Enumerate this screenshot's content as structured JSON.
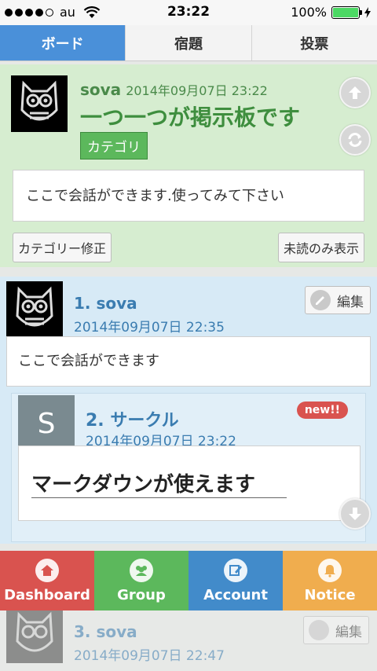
{
  "status": {
    "carrier": "au",
    "time": "23:22",
    "battery": "100%"
  },
  "tabs": [
    {
      "label": "ボード"
    },
    {
      "label": "宿題"
    },
    {
      "label": "投票"
    }
  ],
  "board": {
    "author": "sova",
    "date": "2014年09月07日 23:22",
    "title": "一つ一つが掲示板です",
    "category": "カテゴリ",
    "description": "ここで会話ができます.使ってみて下さい",
    "category_button": "カテゴリー修正",
    "unread_button": "未読のみ表示"
  },
  "posts": [
    {
      "name": "1. sova",
      "date": "2014年09月07日 22:35",
      "edit_label": "編集",
      "body": "ここで会話ができます"
    },
    {
      "name": "2. サークル",
      "date": "2014年09月07日 23:22",
      "avatar_letter": "S",
      "badge": "new!!",
      "body": "マークダウンが使えます"
    },
    {
      "name": "3. sova",
      "date": "2014年09月07日 22:47",
      "edit_label": "編集"
    }
  ],
  "bottom_nav": [
    {
      "label": "Dashboard",
      "icon": "home-icon",
      "color": "#d9534f"
    },
    {
      "label": "Group",
      "icon": "group-icon",
      "color": "#5cb85c"
    },
    {
      "label": "Account",
      "icon": "edit-icon",
      "color": "#428bca"
    },
    {
      "label": "Notice",
      "icon": "bell-icon",
      "color": "#f0ad4e"
    }
  ]
}
